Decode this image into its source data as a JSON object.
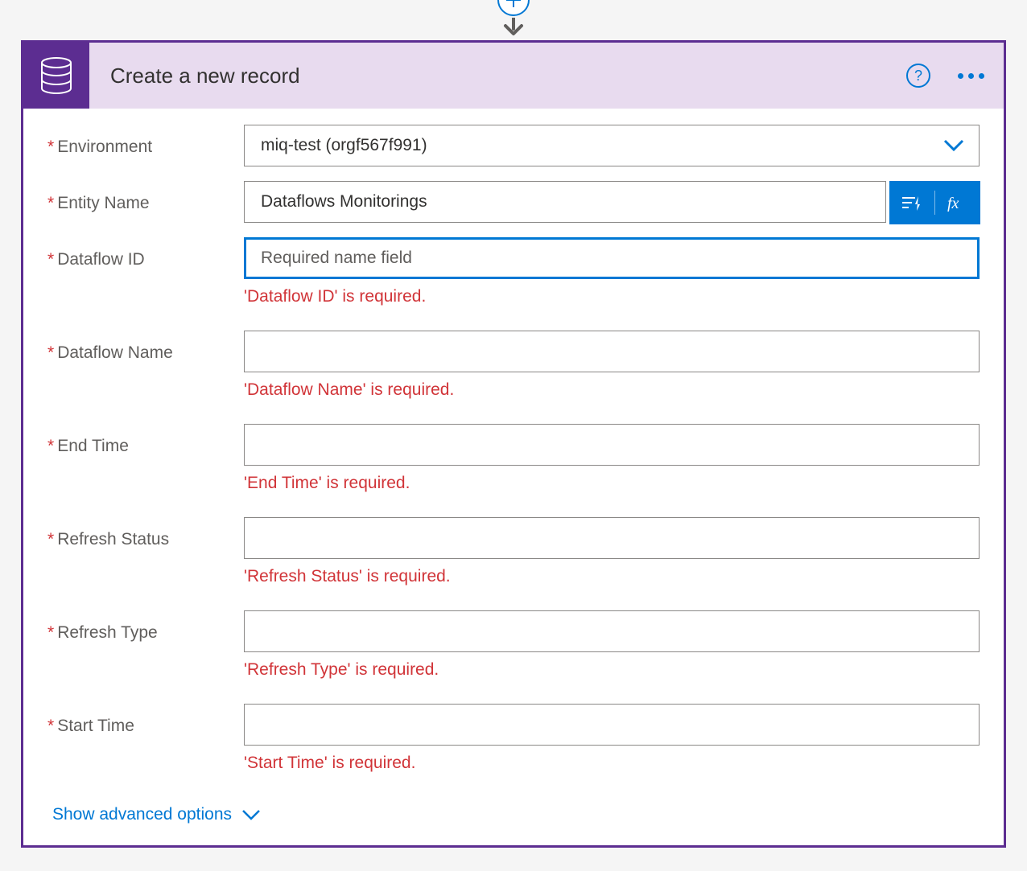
{
  "header": {
    "title": "Create a new record",
    "help_tooltip": "?"
  },
  "fields": {
    "environment": {
      "label": "Environment",
      "value": "miq-test (orgf567f991)"
    },
    "entity_name": {
      "label": "Entity Name",
      "value": "Dataflows Monitorings"
    },
    "dataflow_id": {
      "label": "Dataflow ID",
      "placeholder": "Required name field",
      "value": "",
      "error": "'Dataflow ID' is required."
    },
    "dataflow_name": {
      "label": "Dataflow Name",
      "value": "",
      "error": "'Dataflow Name' is required."
    },
    "end_time": {
      "label": "End Time",
      "value": "",
      "error": "'End Time' is required."
    },
    "refresh_status": {
      "label": "Refresh Status",
      "value": "",
      "error": "'Refresh Status' is required."
    },
    "refresh_type": {
      "label": "Refresh Type",
      "value": "",
      "error": "'Refresh Type' is required."
    },
    "start_time": {
      "label": "Start Time",
      "value": "",
      "error": "'Start Time' is required."
    }
  },
  "footer": {
    "advanced_options": "Show advanced options"
  }
}
